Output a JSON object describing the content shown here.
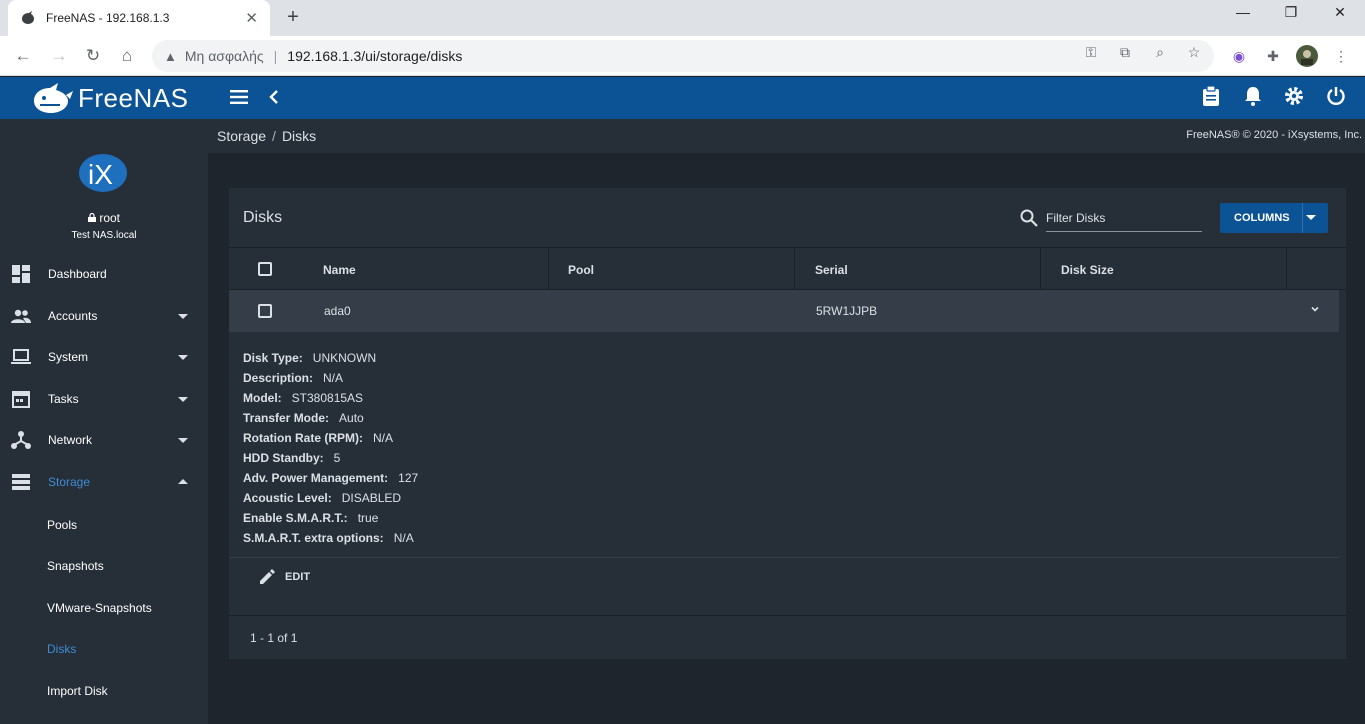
{
  "browser": {
    "tab_title": "FreeNAS - 192.168.1.3",
    "tab_close": "✕",
    "new_tab": "+",
    "insecure_label": "Μη ασφαλής",
    "url": "192.168.1.3/ui/storage/disks",
    "window_controls": [
      "—",
      "❐",
      "✕"
    ]
  },
  "app": {
    "brand": "FreeNAS",
    "brand_color": "#0b5394",
    "accent_color": "#3e8dd6"
  },
  "sidebar": {
    "user": "root",
    "hostname": "Test NAS.local",
    "items": [
      {
        "label": "Dashboard",
        "icon": "dashboard-icon",
        "expandable": false
      },
      {
        "label": "Accounts",
        "icon": "people-icon",
        "expandable": true
      },
      {
        "label": "System",
        "icon": "laptop-icon",
        "expandable": true
      },
      {
        "label": "Tasks",
        "icon": "calendar-icon",
        "expandable": true
      },
      {
        "label": "Network",
        "icon": "network-icon",
        "expandable": true
      },
      {
        "label": "Storage",
        "icon": "storage-icon",
        "expandable": true,
        "active": true
      }
    ],
    "storage_sub": [
      {
        "label": "Pools"
      },
      {
        "label": "Snapshots"
      },
      {
        "label": "VMware-Snapshots"
      },
      {
        "label": "Disks",
        "active": true
      },
      {
        "label": "Import Disk"
      }
    ]
  },
  "breadcrumb": {
    "items": [
      "Storage",
      "Disks"
    ],
    "separator": "/"
  },
  "copyright": "FreeNAS® © 2020 - iXsystems, Inc.",
  "disks": {
    "title": "Disks",
    "filter_placeholder": "Filter Disks",
    "columns_button": "COLUMNS",
    "columns": [
      "Name",
      "Pool",
      "Serial",
      "Disk Size"
    ],
    "rows": [
      {
        "name": "ada0",
        "pool": "",
        "serial": "5RW1JJPB",
        "size": ""
      }
    ],
    "details": [
      {
        "key": "Disk Type:",
        "value": "UNKNOWN"
      },
      {
        "key": "Description:",
        "value": "N/A"
      },
      {
        "key": "Model:",
        "value": "ST380815AS"
      },
      {
        "key": "Transfer Mode:",
        "value": "Auto"
      },
      {
        "key": "Rotation Rate (RPM):",
        "value": "N/A"
      },
      {
        "key": "HDD Standby:",
        "value": "5"
      },
      {
        "key": "Adv. Power Management:",
        "value": "127"
      },
      {
        "key": "Acoustic Level:",
        "value": "DISABLED"
      },
      {
        "key": "Enable S.M.A.R.T.:",
        "value": "true"
      },
      {
        "key": "S.M.A.R.T. extra options:",
        "value": "N/A"
      }
    ],
    "edit_label": "EDIT",
    "pagination": "1 - 1 of 1"
  }
}
